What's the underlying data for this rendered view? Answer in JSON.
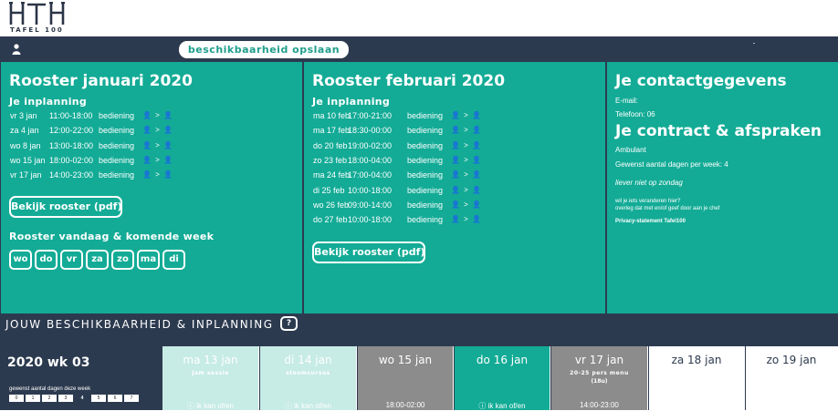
{
  "logo": {
    "brand": "HTH",
    "tagline": "TAFEL 100"
  },
  "nav": {
    "save_label": "beschikbaarheid opslaan"
  },
  "january": {
    "title": "Rooster januari 2020",
    "planning_label": "Je inplanning",
    "shifts": [
      {
        "date": "vr 3 jan",
        "time": "11:00-18:00",
        "role": "bediening",
        "icons": "👤 > 👤"
      },
      {
        "date": "za 4 jan",
        "time": "12:00-22:00",
        "role": "bediening",
        "icons": "👤 > 👤"
      },
      {
        "date": "wo 8 jan",
        "time": "13:00-18:00",
        "role": "bediening",
        "icons": "👤 > 👤"
      },
      {
        "date": "wo 15 jan",
        "time": "18:00-02:00",
        "role": "bediening",
        "icons": "👤 > 👤"
      },
      {
        "date": "vr 17 jan",
        "time": "14:00-23:00",
        "role": "bediening",
        "icons": "👤 > 👤"
      }
    ],
    "view_button": "Bekijk rooster (pdf)",
    "week_label": "Rooster vandaag & komende week",
    "day_buttons": [
      "wo",
      "do",
      "vr",
      "za",
      "zo",
      "ma",
      "di"
    ]
  },
  "february": {
    "title": "Rooster februari 2020",
    "planning_label": "Je inplanning",
    "shifts": [
      {
        "date": "ma 10 feb",
        "time": "17:00-21:00",
        "role": "bediening",
        "icons": "👤 > 👤"
      },
      {
        "date": "ma 17 feb",
        "time": "18:30-00:00",
        "role": "bediening",
        "icons": "👤 > 👤"
      },
      {
        "date": "do 20 feb",
        "time": "19:00-02:00",
        "role": "bediening",
        "icons": "👤 > 👤"
      },
      {
        "date": "zo 23 feb",
        "time": "18:00-04:00",
        "role": "bediening",
        "icons": "👤 > 👤"
      },
      {
        "date": "ma 24 feb",
        "time": "17:00-04:00",
        "role": "bediening",
        "icons": "👤 > 👤"
      },
      {
        "date": "di 25 feb",
        "time": "10:00-18:00",
        "role": "bediening",
        "icons": "👤 > 👤"
      },
      {
        "date": "wo 26 feb",
        "time": "09:00-14:00",
        "role": "bediening",
        "icons": "👤 > 👤"
      },
      {
        "date": "do 27 feb",
        "time": "10:00-18:00",
        "role": "bediening",
        "icons": "👤 > 👤"
      }
    ],
    "view_button": "Bekijk rooster (pdf)"
  },
  "contact": {
    "title": "Je contactgegevens",
    "email_label": "E-mail:",
    "phone_label": "Telefoon: 06",
    "contract_title": "Je contract & afspraken",
    "contract_type": "Ambulant",
    "days_per_week": "Gewenst aantal dagen per week: 4",
    "preference": "liever niet op zondag",
    "change_line1": "wil je iets veranderen hier?",
    "change_line2": "overleg dat met en/of geef door aan je chef",
    "privacy": "Privacy-statement Tafel100"
  },
  "availability": {
    "title": "JOUW BESCHIKBAARHEID & INPLANNING",
    "help": "?",
    "week_title": "2020 wk 03",
    "days_wanted_label": "gewenst aantal dagen deze week",
    "day_counts": [
      "0",
      "1",
      "2",
      "3",
      "4",
      "5",
      "6",
      "7"
    ],
    "selected_count": "4",
    "days": [
      {
        "name": "ma 13 jan",
        "sub": "Jam sessie",
        "sub2": "",
        "foot": "ⓘ ik kan of/en",
        "color": "#c7ebe5"
      },
      {
        "name": "di 14 jan",
        "sub": "stoomcursus",
        "sub2": "",
        "foot": "ⓘ ik kan of/en",
        "color": "#c7ebe5"
      },
      {
        "name": "wo 15 jan",
        "sub": "",
        "sub2": "",
        "foot": "18:00-02:00",
        "color": "#8c8c8c"
      },
      {
        "name": "do 16 jan",
        "sub": "",
        "sub2": "",
        "foot": "ⓘ ik kan of/en",
        "color": "#13ab96"
      },
      {
        "name": "vr 17 jan",
        "sub": "20-25 pers menu",
        "sub2": "(18u)",
        "foot": "14:00-23:00",
        "color": "#8c8c8c"
      },
      {
        "name": "za 18 jan",
        "sub": "",
        "sub2": "",
        "foot": "",
        "color": "#ffffff"
      },
      {
        "name": "zo 19 jan",
        "sub": "",
        "sub2": "",
        "foot": "",
        "color": "#ffffff"
      }
    ]
  },
  "colors": {
    "teal": "#13ab96",
    "navy": "#2c3a4f",
    "pale_teal": "#c7ebe5",
    "grey": "#8c8c8c"
  }
}
